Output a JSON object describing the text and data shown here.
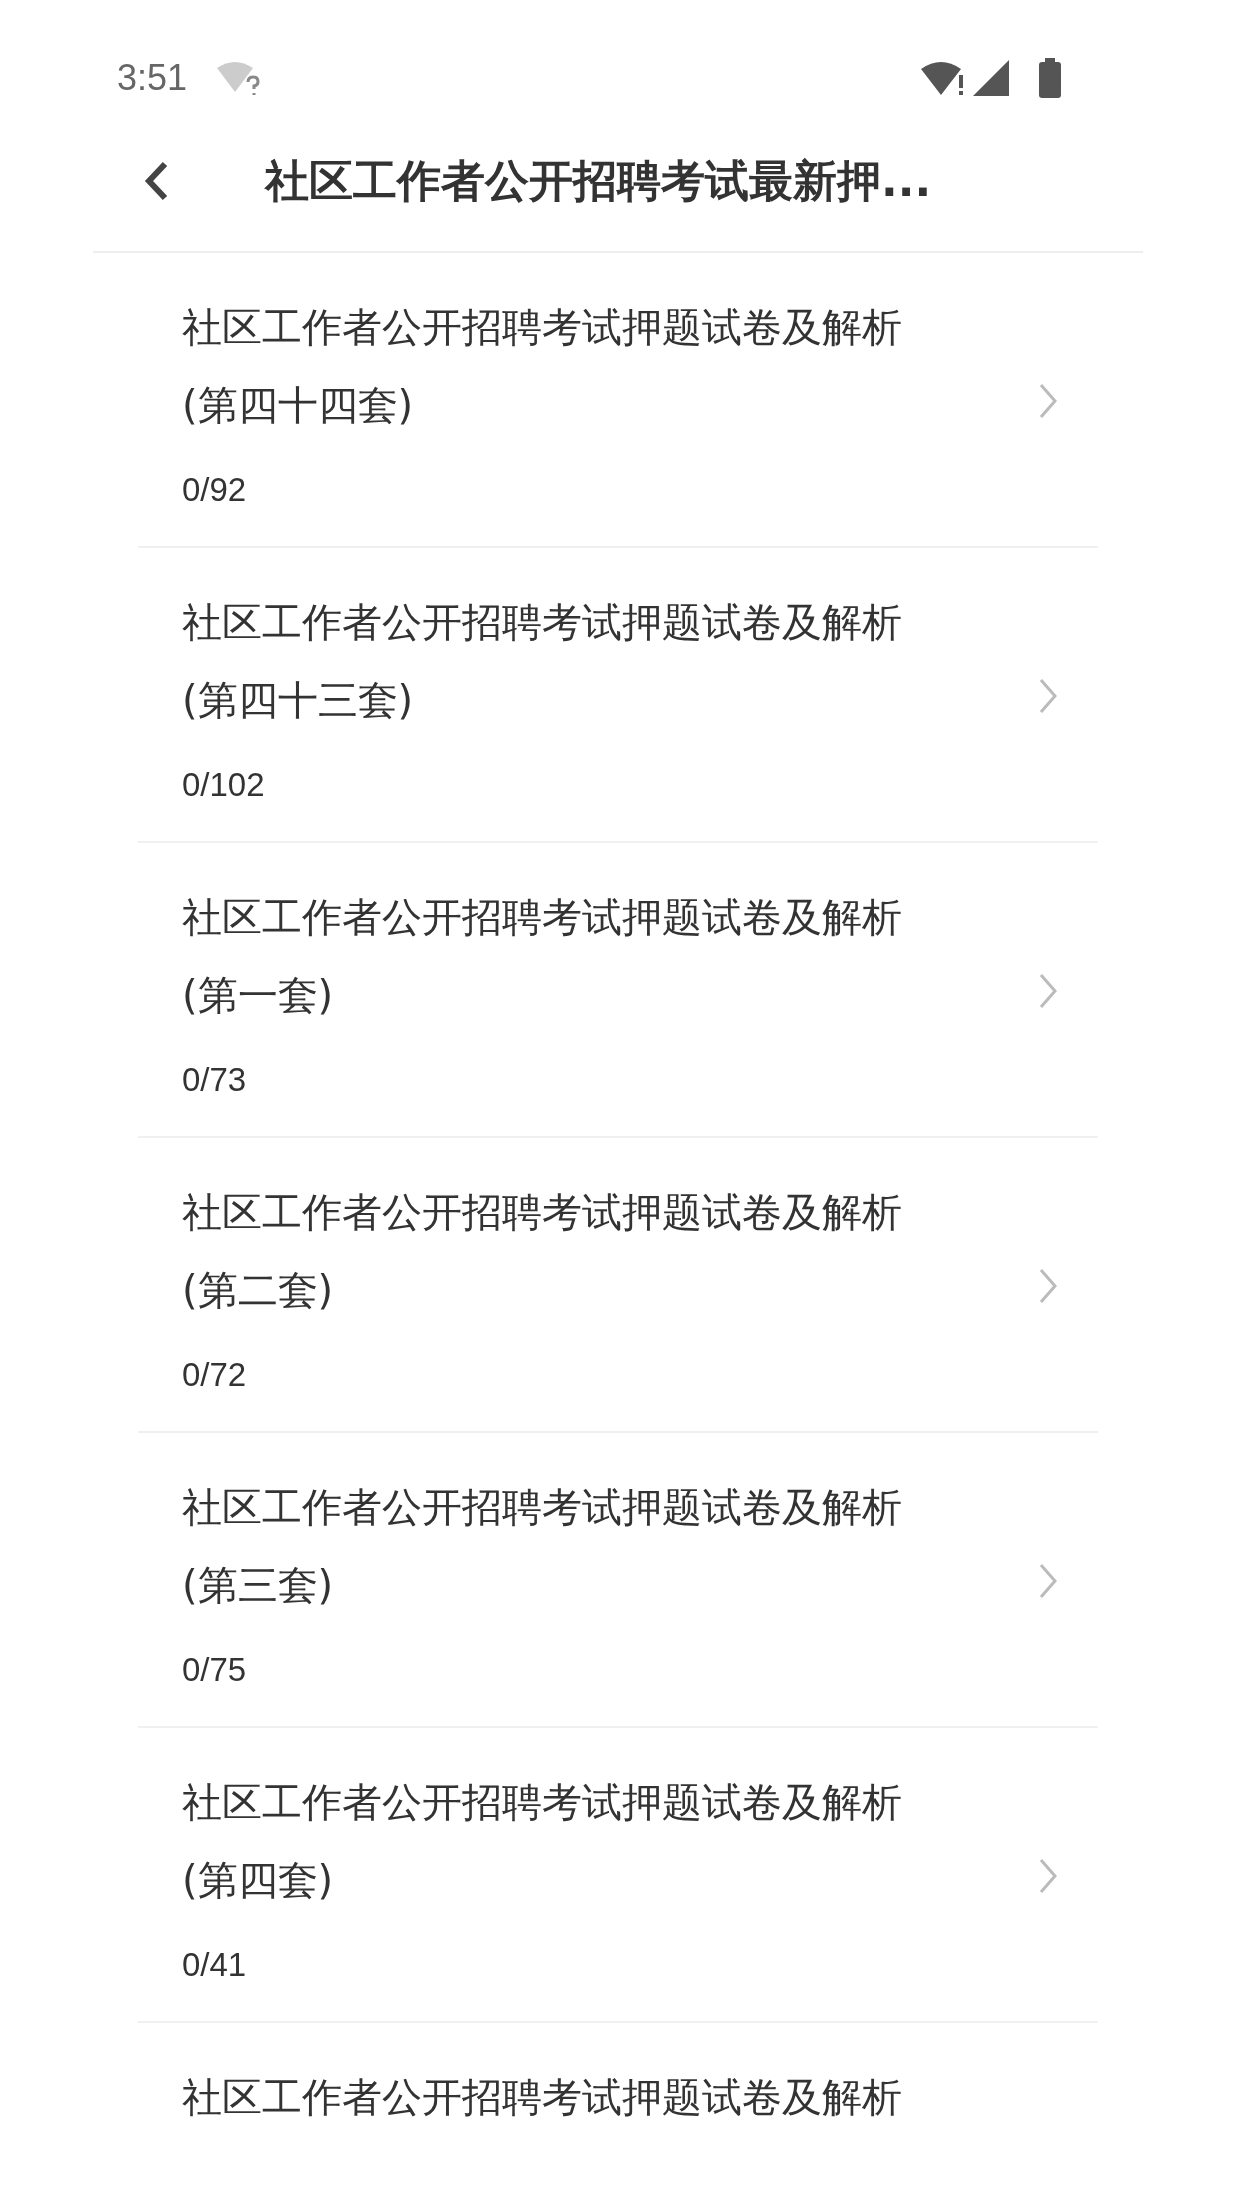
{
  "status_bar": {
    "time": "3:51"
  },
  "header": {
    "title": "社区工作者公开招聘考试最新押..."
  },
  "items": [
    {
      "title": "社区工作者公开招聘考试押题试卷及解析",
      "subtitle": "(第四十四套)",
      "progress": "0/92"
    },
    {
      "title": "社区工作者公开招聘考试押题试卷及解析",
      "subtitle": "(第四十三套)",
      "progress": "0/102"
    },
    {
      "title": "社区工作者公开招聘考试押题试卷及解析",
      "subtitle": "(第一套)",
      "progress": "0/73"
    },
    {
      "title": "社区工作者公开招聘考试押题试卷及解析",
      "subtitle": "(第二套)",
      "progress": "0/72"
    },
    {
      "title": "社区工作者公开招聘考试押题试卷及解析",
      "subtitle": "(第三套)",
      "progress": "0/75"
    },
    {
      "title": "社区工作者公开招聘考试押题试卷及解析",
      "subtitle": "(第四套)",
      "progress": "0/41"
    },
    {
      "title": "社区工作者公开招聘考试押题试卷及解析"
    }
  ]
}
